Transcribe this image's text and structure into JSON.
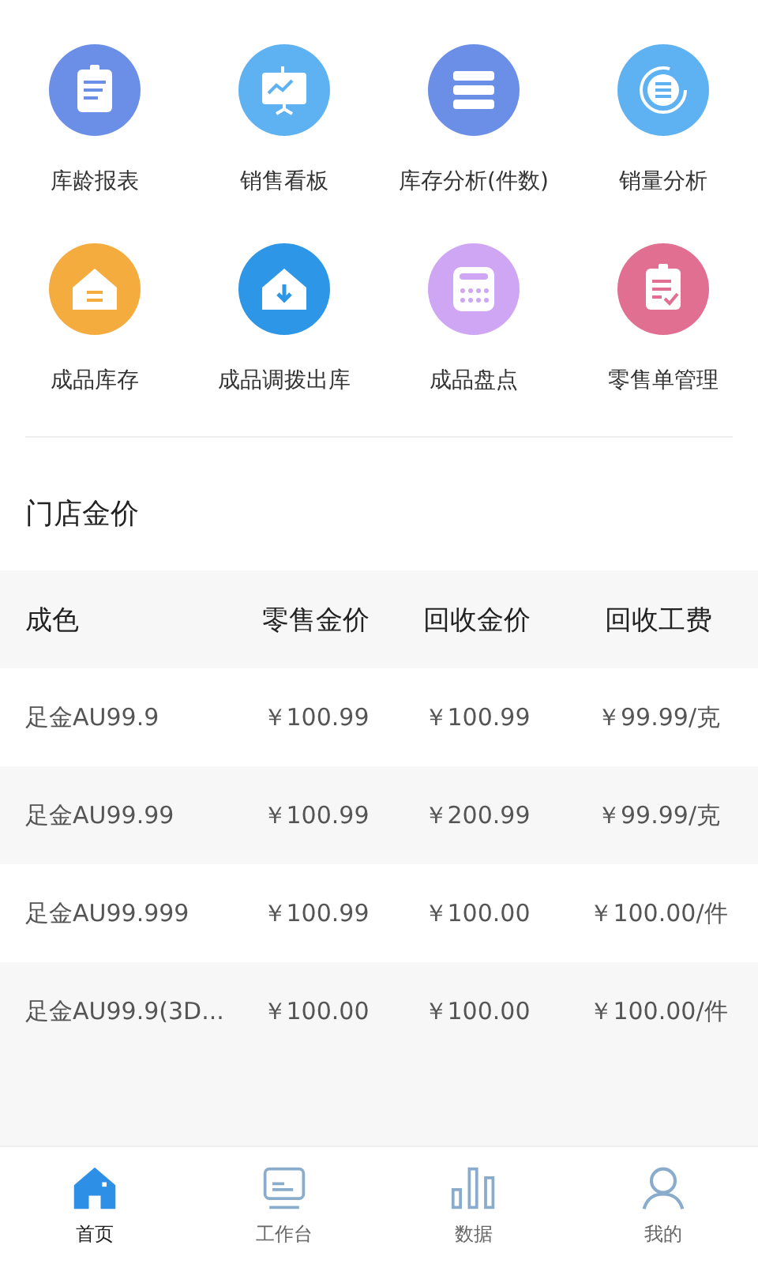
{
  "shortcuts": [
    {
      "label": "库龄报表",
      "kind": "clipboard",
      "color": "#6b8fe6"
    },
    {
      "label": "销售看板",
      "kind": "board",
      "color": "#5fb2f2"
    },
    {
      "label": "库存分析(件数)",
      "kind": "server",
      "color": "#6b8fe6"
    },
    {
      "label": "销量分析",
      "kind": "ring",
      "color": "#5fb2f2"
    },
    {
      "label": "成品库存",
      "kind": "house",
      "color": "#f5ac3f"
    },
    {
      "label": "成品调拨出库",
      "kind": "house-down",
      "color": "#2e96e6"
    },
    {
      "label": "成品盘点",
      "kind": "calculator",
      "color": "#cfa6f4"
    },
    {
      "label": "零售单管理",
      "kind": "checklist",
      "color": "#e06f92"
    }
  ],
  "section_title": "门店金价",
  "table": {
    "columns": [
      "成色",
      "零售金价",
      "回收金价",
      "回收工费"
    ],
    "rows": [
      [
        "足金AU99.9",
        "￥100.99",
        "￥100.99",
        "￥99.99/克"
      ],
      [
        "足金AU99.99",
        "￥100.99",
        "￥200.99",
        "￥99.99/克"
      ],
      [
        "足金AU99.999",
        "￥100.99",
        "￥100.00",
        "￥100.00/件"
      ],
      [
        "足金AU99.9(3D...",
        "￥100.00",
        "￥100.00",
        "￥100.00/件"
      ]
    ]
  },
  "tabs": [
    {
      "label": "首页",
      "kind": "home",
      "selected": true
    },
    {
      "label": "工作台",
      "kind": "desk",
      "selected": false
    },
    {
      "label": "数据",
      "kind": "bars",
      "selected": false
    },
    {
      "label": "我的",
      "kind": "person",
      "selected": false
    }
  ]
}
